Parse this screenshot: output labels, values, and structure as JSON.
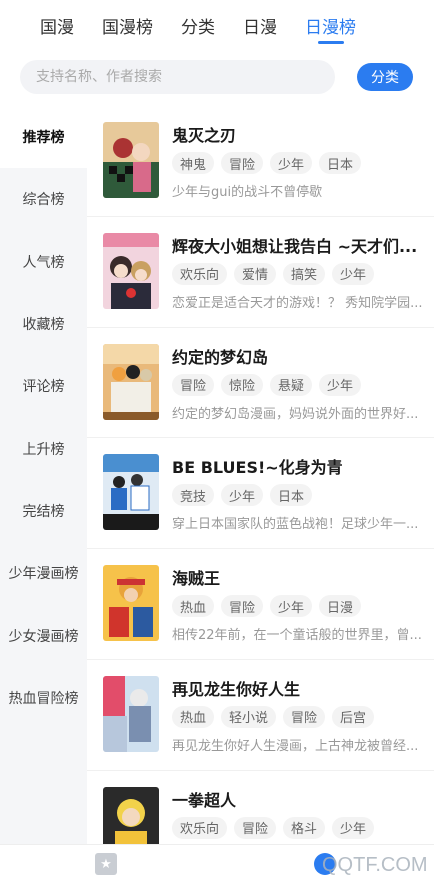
{
  "tabs": [
    "国漫",
    "国漫榜",
    "分类",
    "日漫",
    "日漫榜"
  ],
  "active_tab": 4,
  "search": {
    "placeholder": "支持名称、作者搜索"
  },
  "category_button": "分类",
  "sidebar": {
    "items": [
      {
        "label": "推荐榜",
        "active": true
      },
      {
        "label": "综合榜"
      },
      {
        "label": "人气榜"
      },
      {
        "label": "收藏榜"
      },
      {
        "label": "评论榜"
      },
      {
        "label": "上升榜"
      },
      {
        "label": "完结榜"
      },
      {
        "label": "少年漫画榜"
      },
      {
        "label": "少女漫画榜"
      },
      {
        "label": "热血冒险榜"
      }
    ]
  },
  "manga": [
    {
      "title": "鬼灭之刃",
      "tags": [
        "神鬼",
        "冒险",
        "少年",
        "日本"
      ],
      "desc": "少年与gui的战斗不曾停歇"
    },
    {
      "title": "辉夜大小姐想让我告白 ~天才们...",
      "tags": [
        "欢乐向",
        "爱情",
        "搞笑",
        "少年"
      ],
      "desc": "恋爱正是适合天才的游戏！？ 秀知院学园..."
    },
    {
      "title": "约定的梦幻岛",
      "tags": [
        "冒险",
        "惊险",
        "悬疑",
        "少年"
      ],
      "desc": "约定的梦幻岛漫画，妈妈说外面的世界好..."
    },
    {
      "title": "BE BLUES!~化身为青",
      "tags": [
        "竞技",
        "少年",
        "日本"
      ],
      "desc": "穿上日本国家队的蓝色战袍！足球少年一..."
    },
    {
      "title": "海贼王",
      "tags": [
        "热血",
        "冒险",
        "少年",
        "日漫"
      ],
      "desc": "相传22年前，在一个童话般的世界里，曾..."
    },
    {
      "title": "再见龙生你好人生",
      "tags": [
        "热血",
        "轻小说",
        "冒险",
        "后宫"
      ],
      "desc": "再见龙生你好人生漫画，上古神龙被曾经..."
    },
    {
      "title": "一拳超人",
      "tags": [
        "欢乐向",
        "冒险",
        "格斗",
        "少年"
      ],
      "desc": ""
    }
  ],
  "watermark": "QQTF.COM",
  "colors": {
    "accent": "#2b7cf0"
  }
}
